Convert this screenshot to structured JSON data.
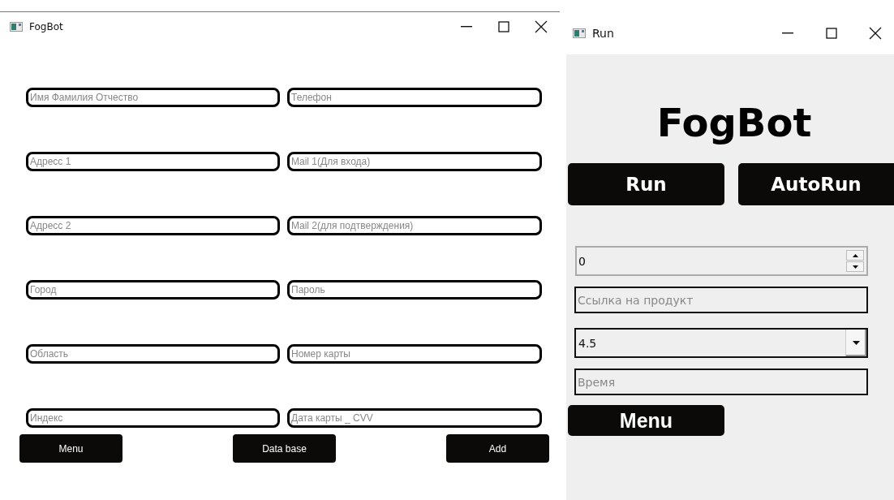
{
  "form_window": {
    "title": "FogBot",
    "fields": [
      {
        "placeholder": "Имя Фамилия Отчество"
      },
      {
        "placeholder": "Телефон"
      },
      {
        "placeholder": "Адресс 1"
      },
      {
        "placeholder": "Mail 1(Для входа)"
      },
      {
        "placeholder": "Адресс 2"
      },
      {
        "placeholder": "Mail 2(для подтверждения)"
      },
      {
        "placeholder": "Город"
      },
      {
        "placeholder": "Пароль"
      },
      {
        "placeholder": "Область"
      },
      {
        "placeholder": "Номер карты"
      },
      {
        "placeholder": "Индекс"
      },
      {
        "placeholder": "Дата карты _ CVV"
      }
    ],
    "buttons": [
      "Menu",
      "Data base",
      "Add"
    ]
  },
  "run_window": {
    "title": "Run",
    "heading": "FogBot",
    "buttons": [
      "Run",
      "AutoRun"
    ],
    "spinbox": {
      "value": "0"
    },
    "link_field": {
      "placeholder": "Ссылка на продукт"
    },
    "dropdown": {
      "value": "4.5"
    },
    "time_field": {
      "placeholder": "Время"
    },
    "menu_button": "Menu"
  }
}
